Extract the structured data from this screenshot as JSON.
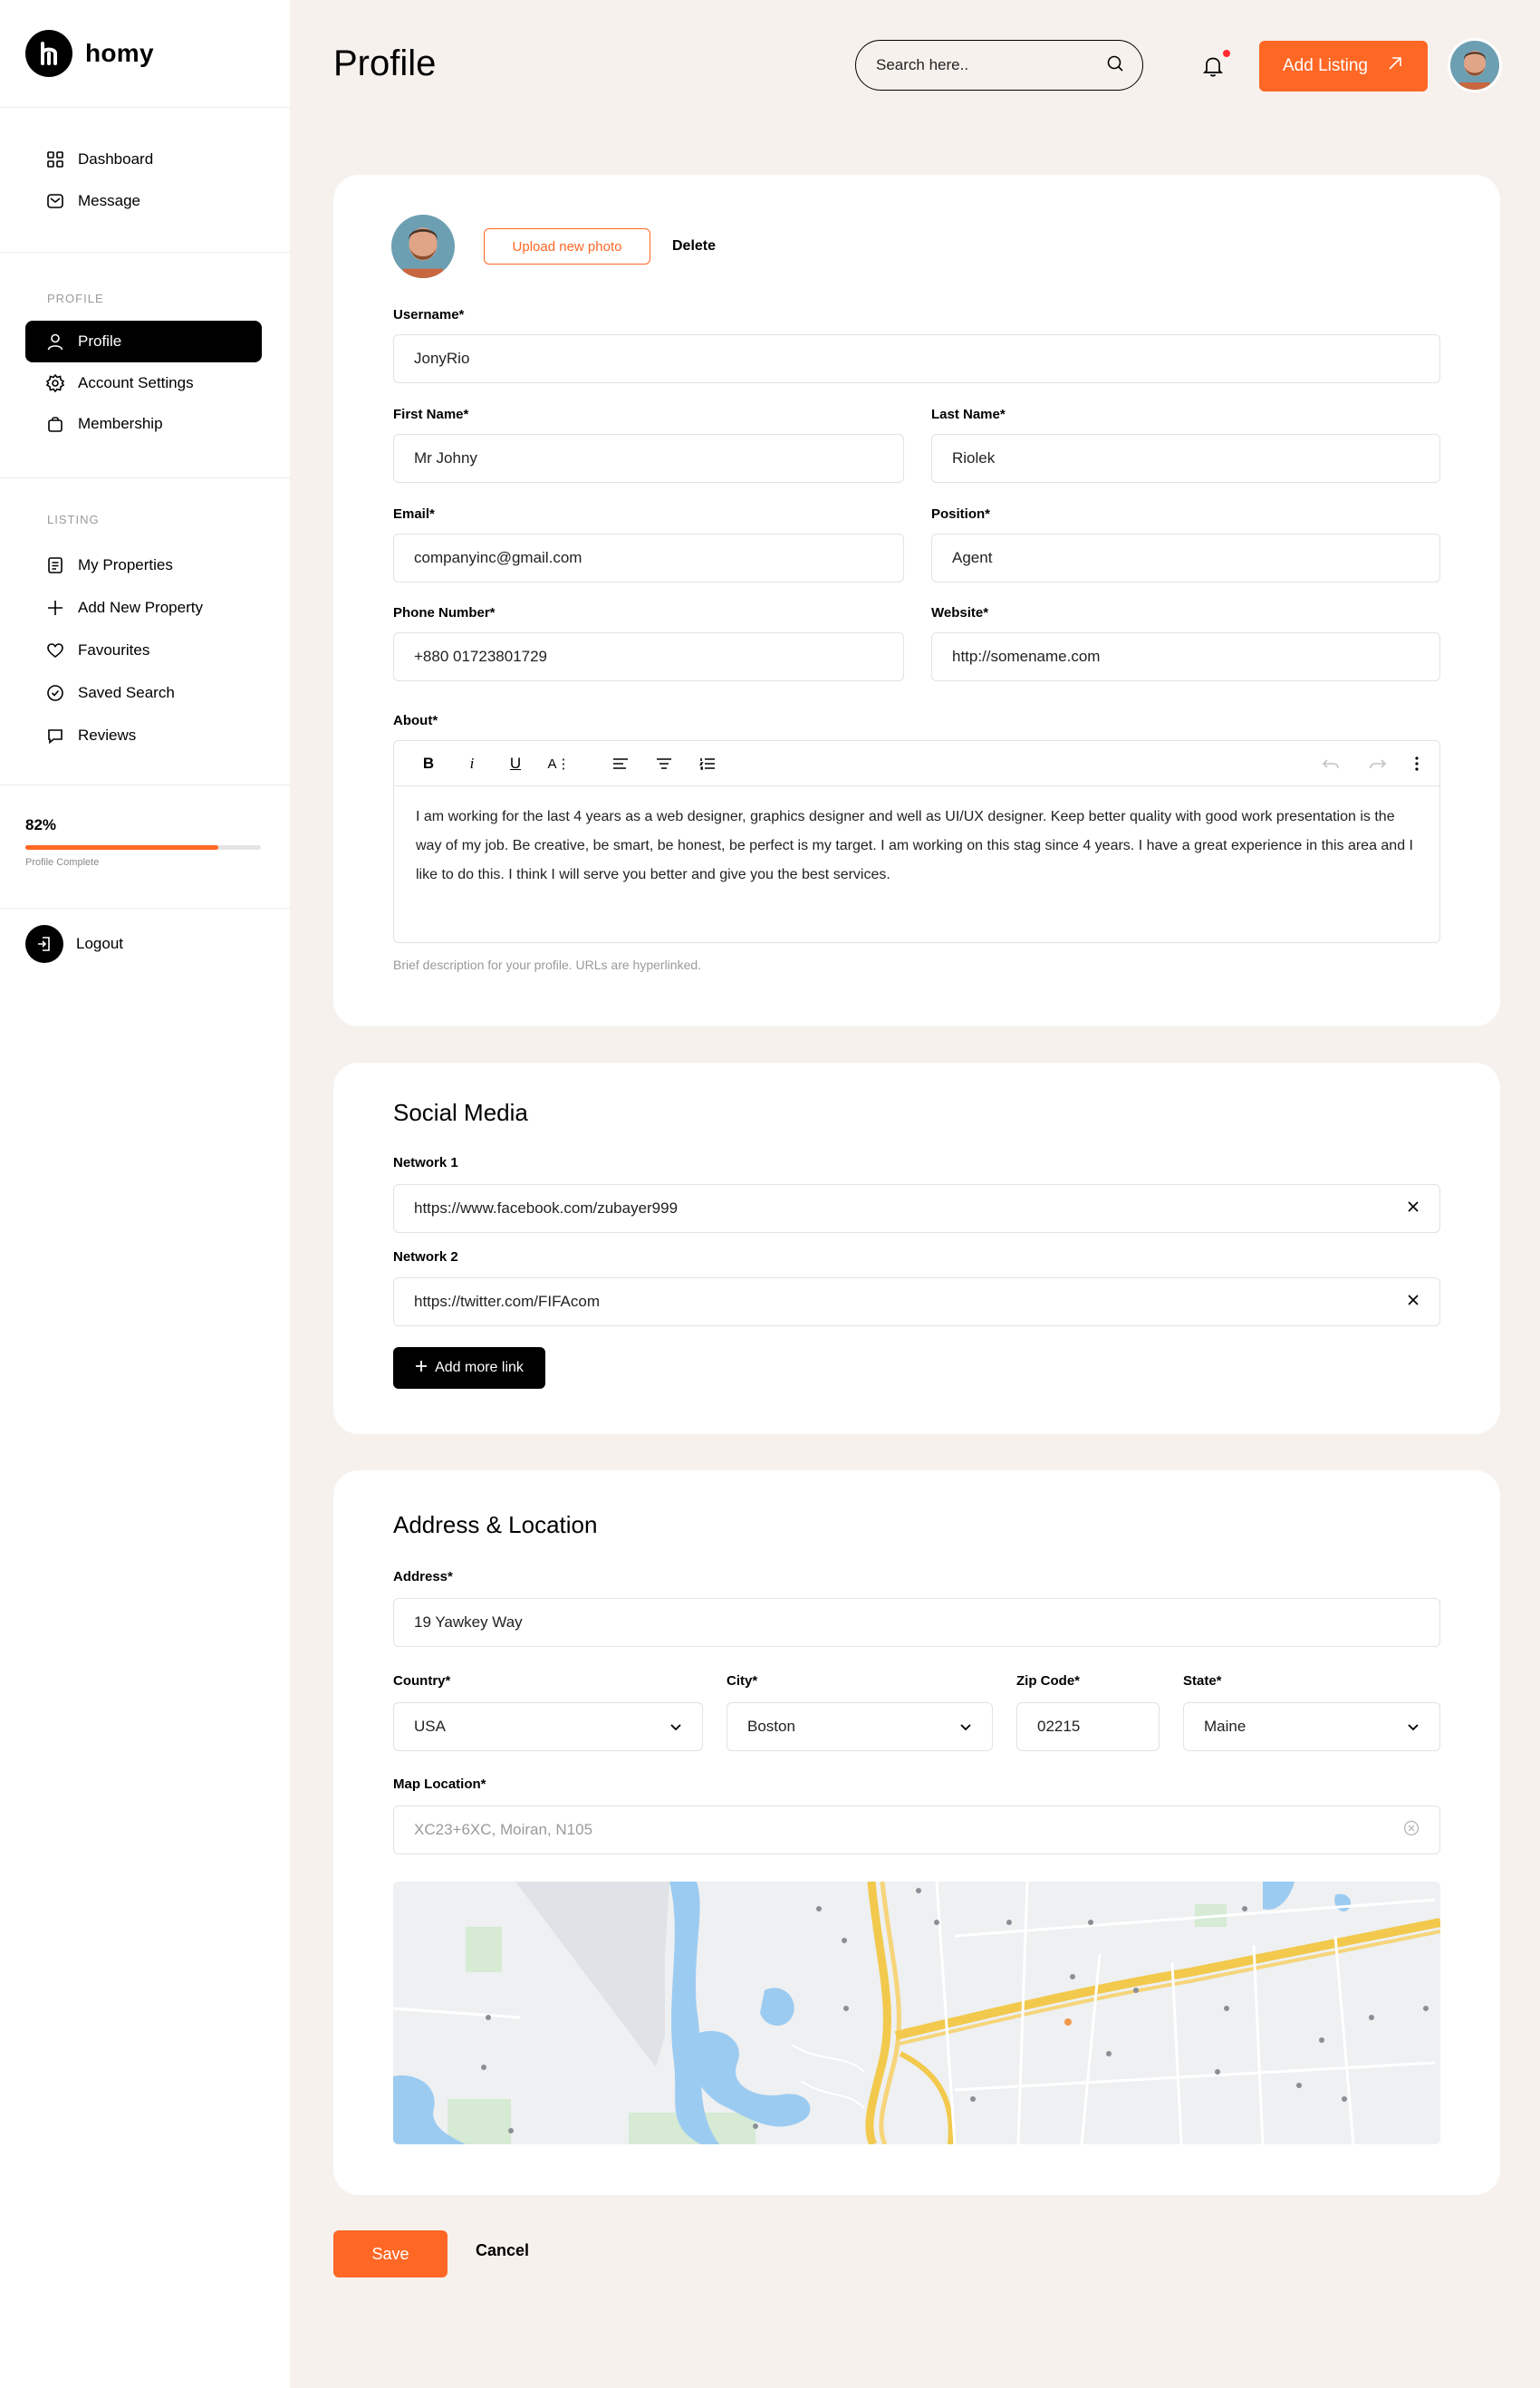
{
  "brand": {
    "name": "homy"
  },
  "sidebar": {
    "top_items": [
      {
        "label": "Dashboard",
        "icon": "grid-icon"
      },
      {
        "label": "Message",
        "icon": "mail-icon"
      }
    ],
    "profile_section": "PROFILE",
    "profile_items": [
      {
        "label": "Profile",
        "icon": "user-icon",
        "active": true
      },
      {
        "label": "Account Settings",
        "icon": "gear-icon"
      },
      {
        "label": "Membership",
        "icon": "bag-icon"
      }
    ],
    "listing_section": "LISTING",
    "listing_items": [
      {
        "label": "My Properties",
        "icon": "document-icon"
      },
      {
        "label": "Add New Property",
        "icon": "plus-icon"
      },
      {
        "label": "Favourites",
        "icon": "heart-icon"
      },
      {
        "label": "Saved Search",
        "icon": "check-circle-icon"
      },
      {
        "label": "Reviews",
        "icon": "chat-icon"
      }
    ],
    "progress": {
      "percent_label": "82%",
      "value": 0.82,
      "label": "Profile Complete"
    },
    "logout_label": "Logout"
  },
  "header": {
    "title": "Profile",
    "search_placeholder": "Search here..",
    "add_listing_label": "Add Listing"
  },
  "profile_form": {
    "upload_label": "Upload new photo",
    "delete_label": "Delete",
    "username": {
      "label": "Username*",
      "value": "JonyRio"
    },
    "first_name": {
      "label": "First Name*",
      "value": "Mr Johny"
    },
    "last_name": {
      "label": "Last Name*",
      "value": "Riolek"
    },
    "email": {
      "label": "Email*",
      "value": "companyinc@gmail.com"
    },
    "position": {
      "label": "Position*",
      "value": "Agent"
    },
    "phone": {
      "label": "Phone Number*",
      "value": "+880 01723801729"
    },
    "website": {
      "label": "Website*",
      "value": "http://somename.com"
    },
    "about": {
      "label": "About*",
      "value": "I am working for the last 4 years as a web designer, graphics designer and well as UI/UX designer. Keep better quality with good work presentation is the way of my job. Be creative, be smart, be honest, be perfect is my target. I am working on this stag since 4 years. I have a great experience in this area and I like to do this. I think I will serve you better and give you the best services.",
      "hint": "Brief description for your profile. URLs are hyperlinked."
    }
  },
  "social": {
    "title": "Social Media",
    "network1": {
      "label": "Network 1",
      "value": "https://www.facebook.com/zubayer999"
    },
    "network2": {
      "label": "Network 2",
      "value": "https://twitter.com/FIFAcom"
    },
    "add_label": "Add more link"
  },
  "address": {
    "title": "Address & Location",
    "address": {
      "label": "Address*",
      "value": "19 Yawkey Way"
    },
    "country": {
      "label": "Country*",
      "value": "USA"
    },
    "city": {
      "label": "City*",
      "value": "Boston"
    },
    "zip": {
      "label": "Zip Code*",
      "value": "02215"
    },
    "state": {
      "label": "State*",
      "value": "Maine"
    },
    "map_location": {
      "label": "Map Location*",
      "placeholder": "XC23+6XC, Moiran, N105"
    }
  },
  "actions": {
    "save_label": "Save",
    "cancel_label": "Cancel"
  },
  "colors": {
    "accent": "#ff6725",
    "background": "#f6f1ec",
    "dark": "#000000"
  }
}
